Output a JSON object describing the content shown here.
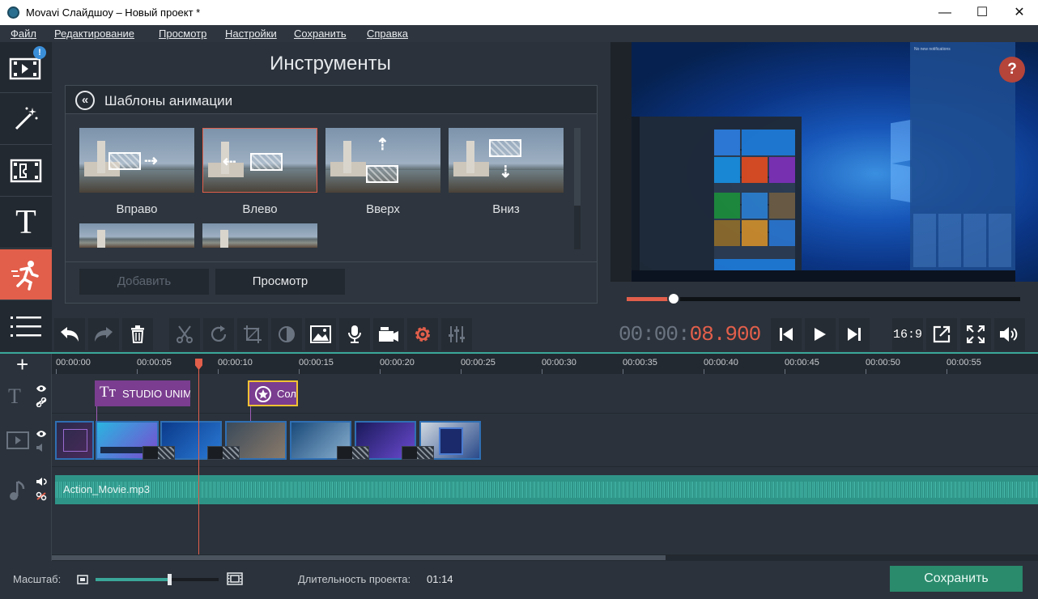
{
  "window": {
    "title": "Movavi Слайдшоу – Новый проект *",
    "minimize": "—",
    "maximize": "☐",
    "close": "✕"
  },
  "menu": [
    "Файл",
    "Редактирование",
    "Просмотр",
    "Настройки",
    "Сохранить",
    "Справка"
  ],
  "sidebar": {
    "items": [
      {
        "name": "import",
        "icon": "film-import-icon",
        "badge": "!"
      },
      {
        "name": "filters",
        "icon": "magic-wand-icon"
      },
      {
        "name": "transitions",
        "icon": "transition-icon"
      },
      {
        "name": "titles",
        "icon": "text-icon",
        "glyph": "T"
      },
      {
        "name": "animation",
        "icon": "running-man-icon",
        "active": true
      },
      {
        "name": "more",
        "icon": "list-icon"
      }
    ]
  },
  "tools": {
    "title": "Инструменты",
    "panel_title": "Шаблоны анимации",
    "templates": [
      {
        "label": "Вправо",
        "direction": "right"
      },
      {
        "label": "Влево",
        "direction": "left",
        "selected": true
      },
      {
        "label": "Вверх",
        "direction": "up"
      },
      {
        "label": "Вниз",
        "direction": "down"
      },
      {
        "label": "",
        "direction": "partial"
      },
      {
        "label": "",
        "direction": "partial"
      }
    ],
    "add_button": "Добавить",
    "preview_button": "Просмотр"
  },
  "preview": {
    "help": "?",
    "notification_text": "No new notifications",
    "progress": 0.12
  },
  "toolbar": {
    "icons": [
      "undo-icon",
      "redo-icon",
      "delete-icon",
      "cut-icon",
      "rotate-icon",
      "crop-icon",
      "color-adjust-icon",
      "image-icon",
      "microphone-icon",
      "camera-icon",
      "settings-icon",
      "equalizer-icon"
    ]
  },
  "transport": {
    "timecode_dim": "00:00:",
    "timecode_red": "08.900",
    "aspect": "16:9",
    "icons": [
      "previous-icon",
      "play-icon",
      "next-icon",
      "aspect-icon",
      "external-preview-icon",
      "fullscreen-icon",
      "volume-icon"
    ]
  },
  "timeline": {
    "add": "+",
    "ticks": [
      "00:00:00",
      "00:00:05",
      "00:00:10",
      "00:00:15",
      "00:00:20",
      "00:00:25",
      "00:00:30",
      "00:00:35",
      "00:00:40",
      "00:00:45",
      "00:00:50",
      "00:00:55"
    ],
    "title_clips": [
      {
        "text": "STUDIO UNIM",
        "icon": "text-tt-icon"
      },
      {
        "text": "Сол",
        "icon": "star-badge-icon"
      }
    ],
    "audio": {
      "name": "Action_Movie.mp3"
    }
  },
  "bottom": {
    "zoom_label": "Масштаб:",
    "zoom_level": 0.6,
    "duration_label": "Длительность проекта:",
    "duration_value": "01:14",
    "save": "Сохранить"
  },
  "colors": {
    "accent": "#e25f4b",
    "teal": "#3aa79a",
    "save": "#2a8a6c",
    "bg": "#2b323b"
  }
}
